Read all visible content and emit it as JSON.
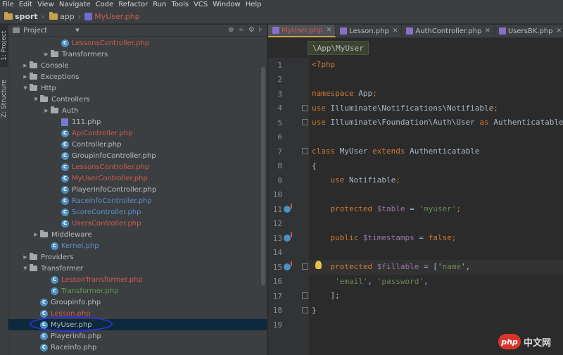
{
  "menu": [
    "File",
    "Edit",
    "View",
    "Navigate",
    "Code",
    "Refactor",
    "Run",
    "Tools",
    "VCS",
    "Window",
    "Help"
  ],
  "breadcrumb": [
    {
      "label": "sport",
      "bold": true
    },
    {
      "label": "app",
      "bold": false
    },
    {
      "label": "MyUser.php",
      "red": true
    }
  ],
  "stripe": {
    "project": "1: Project",
    "structure": "Z: Structure"
  },
  "project_panel": {
    "title": "Project",
    "tools": [
      "⊕",
      "÷",
      "⚙",
      "⊦"
    ]
  },
  "tree": [
    {
      "indent": 5,
      "type": "class",
      "label": "LessonsController.php",
      "style": "red"
    },
    {
      "indent": 4,
      "type": "folder",
      "twisty": "▶",
      "label": "Transformers",
      "style": "normal"
    },
    {
      "indent": 2,
      "type": "folder",
      "twisty": "▶",
      "label": "Console",
      "style": "normal"
    },
    {
      "indent": 2,
      "type": "folder",
      "twisty": "▶",
      "label": "Exceptions",
      "style": "normal"
    },
    {
      "indent": 2,
      "type": "folder",
      "twisty": "▼",
      "label": "Http",
      "style": "normal"
    },
    {
      "indent": 3,
      "type": "folder",
      "twisty": "▼",
      "label": "Controllers",
      "style": "normal"
    },
    {
      "indent": 4,
      "type": "folder",
      "twisty": "▶",
      "label": "Auth",
      "style": "normal"
    },
    {
      "indent": 5,
      "type": "php",
      "label": "111.php",
      "style": "normal"
    },
    {
      "indent": 5,
      "type": "class",
      "label": "ApiController.php",
      "style": "red"
    },
    {
      "indent": 5,
      "type": "class",
      "label": "Controller.php",
      "style": "normal"
    },
    {
      "indent": 5,
      "type": "class",
      "label": "GroupinfoController.php",
      "style": "normal"
    },
    {
      "indent": 5,
      "type": "class",
      "label": "LessonsController.php",
      "style": "red"
    },
    {
      "indent": 5,
      "type": "class",
      "label": "MyUserController.php",
      "style": "red"
    },
    {
      "indent": 5,
      "type": "class",
      "label": "PlayerinfoController.php",
      "style": "normal"
    },
    {
      "indent": 5,
      "type": "class",
      "label": "RaceinfoController.php",
      "style": "blue"
    },
    {
      "indent": 5,
      "type": "class",
      "label": "ScoreController.php",
      "style": "blue"
    },
    {
      "indent": 5,
      "type": "class",
      "label": "UsersController.php",
      "style": "red"
    },
    {
      "indent": 3,
      "type": "folder",
      "twisty": "▶",
      "label": "Middleware",
      "style": "normal"
    },
    {
      "indent": 4,
      "type": "class",
      "label": "Kernel.php",
      "style": "blue"
    },
    {
      "indent": 2,
      "type": "folder",
      "twisty": "▶",
      "label": "Providers",
      "style": "normal"
    },
    {
      "indent": 2,
      "type": "folder",
      "twisty": "▼",
      "label": "Transformer",
      "style": "normal"
    },
    {
      "indent": 4,
      "type": "class",
      "label": "LessonTransformer.php",
      "style": "red"
    },
    {
      "indent": 4,
      "type": "class",
      "label": "Transformer.php",
      "style": "green"
    },
    {
      "indent": 3,
      "type": "class",
      "label": "Groupinfo.php",
      "style": "normal"
    },
    {
      "indent": 3,
      "type": "class",
      "label": "Lesson.php",
      "style": "red"
    },
    {
      "indent": 3,
      "type": "class",
      "label": "MyUser.php",
      "style": "normal",
      "selected": true
    },
    {
      "indent": 3,
      "type": "class",
      "label": "Playerinfo.php",
      "style": "normal"
    },
    {
      "indent": 3,
      "type": "class",
      "label": "Raceinfo.php",
      "style": "normal"
    }
  ],
  "editor_tabs": [
    {
      "label": "MyUser.php",
      "active": true,
      "style": "red"
    },
    {
      "label": "Lesson.php",
      "active": false,
      "style": "normal"
    },
    {
      "label": "AuthController.php",
      "active": false,
      "style": "normal"
    },
    {
      "label": "UsersBK.php",
      "active": false,
      "style": "normal"
    }
  ],
  "namespace_tag": "\\App\\MyUser",
  "code": {
    "line_numbers": [
      "1",
      "2",
      "3",
      "4",
      "5",
      "6",
      "7",
      "8",
      "9",
      "10",
      "11",
      "12",
      "13",
      "14",
      "15",
      "16",
      "17",
      "18",
      "19"
    ],
    "lines": [
      [
        [
          "tag",
          "<?php"
        ]
      ],
      [],
      [
        [
          "kw",
          "namespace "
        ],
        [
          "plain",
          "App"
        ],
        [
          "kw",
          ";"
        ]
      ],
      [
        [
          "kw",
          "use "
        ],
        [
          "plain",
          "Illuminate\\Notifications\\Notifiable"
        ],
        [
          "kw",
          ";"
        ]
      ],
      [
        [
          "kw",
          "use "
        ],
        [
          "plain",
          "Illuminate\\Foundation\\Auth\\User "
        ],
        [
          "kw",
          "as "
        ],
        [
          "plain",
          "Authenticatable"
        ]
      ],
      [],
      [
        [
          "kw",
          "class "
        ],
        [
          "plain",
          "MyUser "
        ],
        [
          "kw",
          "extends "
        ],
        [
          "plain",
          "Authenticatable"
        ]
      ],
      [
        [
          "plain",
          "{"
        ]
      ],
      [
        [
          "plain",
          "    "
        ],
        [
          "kw",
          "use "
        ],
        [
          "plain",
          "Notifiable"
        ],
        [
          "kw",
          ";"
        ]
      ],
      [],
      [
        [
          "plain",
          "    "
        ],
        [
          "kw",
          "protected "
        ],
        [
          "var",
          "$table"
        ],
        [
          "plain",
          " = "
        ],
        [
          "str",
          "'myuser'"
        ],
        [
          "kw",
          ";"
        ]
      ],
      [],
      [
        [
          "plain",
          "    "
        ],
        [
          "kw",
          "public "
        ],
        [
          "var",
          "$timestamps"
        ],
        [
          "plain",
          " = "
        ],
        [
          "kw",
          "false"
        ],
        [
          "kw",
          ";"
        ]
      ],
      [],
      [
        [
          "plain",
          "    "
        ],
        [
          "kw",
          "protected "
        ],
        [
          "var",
          "$fillable"
        ],
        [
          "plain",
          " = ['"
        ],
        [
          "str",
          "name"
        ],
        [
          "plain",
          "',"
        ]
      ],
      [
        [
          "plain",
          "     "
        ],
        [
          "str",
          "'email'"
        ],
        [
          "plain",
          ", "
        ],
        [
          "str",
          "'password'"
        ],
        [
          "plain",
          ","
        ]
      ],
      [
        [
          "plain",
          "    ];"
        ]
      ],
      [
        [
          "plain",
          "}"
        ]
      ],
      []
    ],
    "marked_lines": [
      11,
      13,
      15
    ],
    "fold_lines": [
      4,
      5,
      7,
      15,
      17,
      18
    ],
    "current_line": 15
  },
  "watermark": {
    "logo": "php",
    "text": "中文网"
  }
}
